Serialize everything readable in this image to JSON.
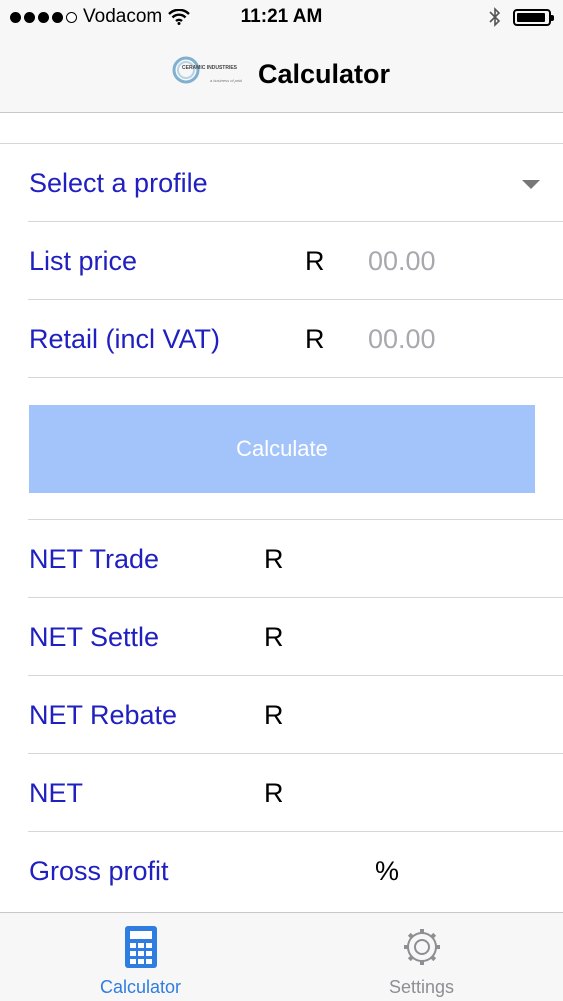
{
  "status_bar": {
    "carrier": "Vodacom",
    "time": "11:21 AM",
    "signal_icon": "signal-dots-icon",
    "wifi_icon": "wifi-icon",
    "bluetooth_icon": "bluetooth-icon",
    "battery_icon": "battery-icon"
  },
  "nav": {
    "title": "Calculator",
    "logo_text": "CERAMIC INDUSTRIES",
    "logo_subtext": "a business of pride"
  },
  "form": {
    "profile_select": {
      "label": "Select a profile",
      "icon": "dropdown-arrow-icon"
    },
    "list_price": {
      "label": "List price",
      "currency": "R",
      "placeholder": "00.00"
    },
    "retail_price": {
      "label": "Retail (incl VAT)",
      "currency": "R",
      "placeholder": "00.00"
    },
    "calculate_button": {
      "label": "Calculate",
      "color": "#a3c4fb"
    }
  },
  "results": [
    {
      "label": "NET Trade",
      "unit": "R"
    },
    {
      "label": "NET Settle",
      "unit": "R"
    },
    {
      "label": "NET Rebate",
      "unit": "R"
    },
    {
      "label": "NET",
      "unit": "R"
    },
    {
      "label": "Gross profit",
      "unit": "%"
    }
  ],
  "tabbar": {
    "tabs": [
      {
        "label": "Calculator",
        "icon": "calculator-icon",
        "active": true,
        "color": "#2f7de1"
      },
      {
        "label": "Settings",
        "icon": "gear-icon",
        "active": false,
        "color": "#8e8e93"
      }
    ]
  },
  "colors": {
    "label_blue": "#2020c0",
    "placeholder_gray": "#a8a8ae",
    "button_bg": "#a3c4fb"
  }
}
